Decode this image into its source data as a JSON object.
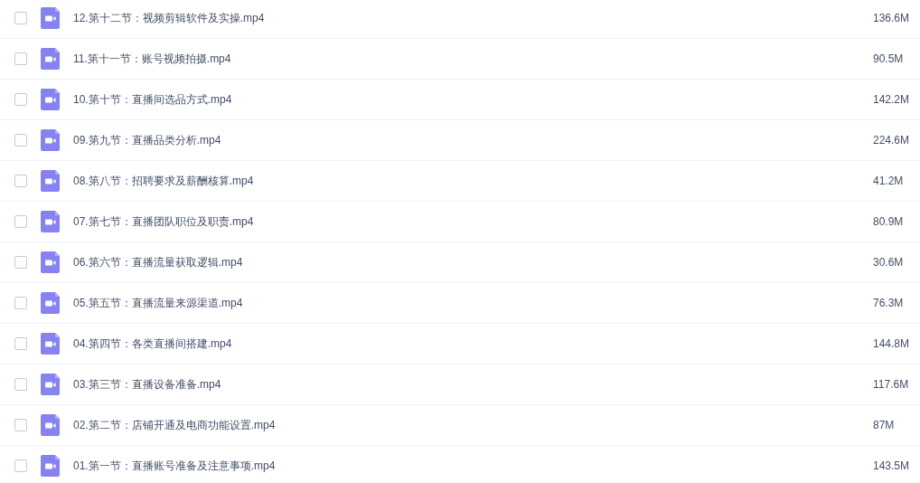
{
  "files": [
    {
      "name": "12.第十二节：视频剪辑软件及实操.mp4",
      "size": "136.6M",
      "checked": false
    },
    {
      "name": "11.第十一节：账号视频拍摄.mp4",
      "size": "90.5M",
      "checked": false
    },
    {
      "name": "10.第十节：直播间选品方式.mp4",
      "size": "142.2M",
      "checked": false
    },
    {
      "name": "09.第九节：直播品类分析.mp4",
      "size": "224.6M",
      "checked": false
    },
    {
      "name": "08.第八节：招聘要求及薪酬核算.mp4",
      "size": "41.2M",
      "checked": false
    },
    {
      "name": "07.第七节：直播团队职位及职责.mp4",
      "size": "80.9M",
      "checked": false
    },
    {
      "name": "06.第六节：直播流量获取逻辑.mp4",
      "size": "30.6M",
      "checked": false
    },
    {
      "name": "05.第五节：直播流量来源渠道.mp4",
      "size": "76.3M",
      "checked": false
    },
    {
      "name": "04.第四节：各类直播间搭建.mp4",
      "size": "144.8M",
      "checked": false
    },
    {
      "name": "03.第三节：直播设备准备.mp4",
      "size": "117.6M",
      "checked": false
    },
    {
      "name": "02.第二节：店铺开通及电商功能设置.mp4",
      "size": "87M",
      "checked": false
    },
    {
      "name": "01.第一节：直播账号准备及注意事项.mp4",
      "size": "143.5M",
      "checked": false
    }
  ]
}
